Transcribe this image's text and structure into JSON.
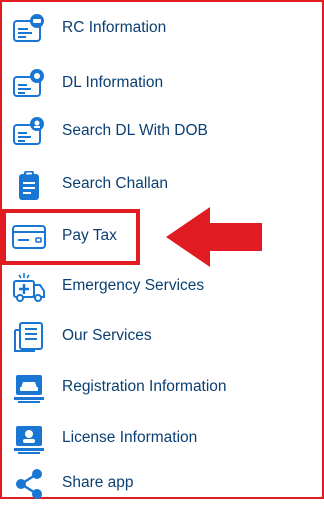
{
  "accent_color": "#e11b22",
  "icon_color": "#1976d2",
  "text_color": "#0b3f73",
  "menu": {
    "items": [
      {
        "label": "RC Information",
        "icon": "rc-card-icon"
      },
      {
        "label": "DL Information",
        "icon": "dl-card-icon"
      },
      {
        "label": "Search DL With DOB",
        "icon": "dl-search-icon"
      },
      {
        "label": "Search Challan",
        "icon": "clipboard-icon"
      },
      {
        "label": "Pay Tax",
        "icon": "credit-card-icon"
      },
      {
        "label": "Emergency Services",
        "icon": "ambulance-icon"
      },
      {
        "label": "Our Services",
        "icon": "services-document-icon"
      },
      {
        "label": "Registration Information",
        "icon": "car-registration-icon"
      },
      {
        "label": "License Information",
        "icon": "license-icon"
      },
      {
        "label": "Share app",
        "icon": "share-icon"
      }
    ]
  }
}
